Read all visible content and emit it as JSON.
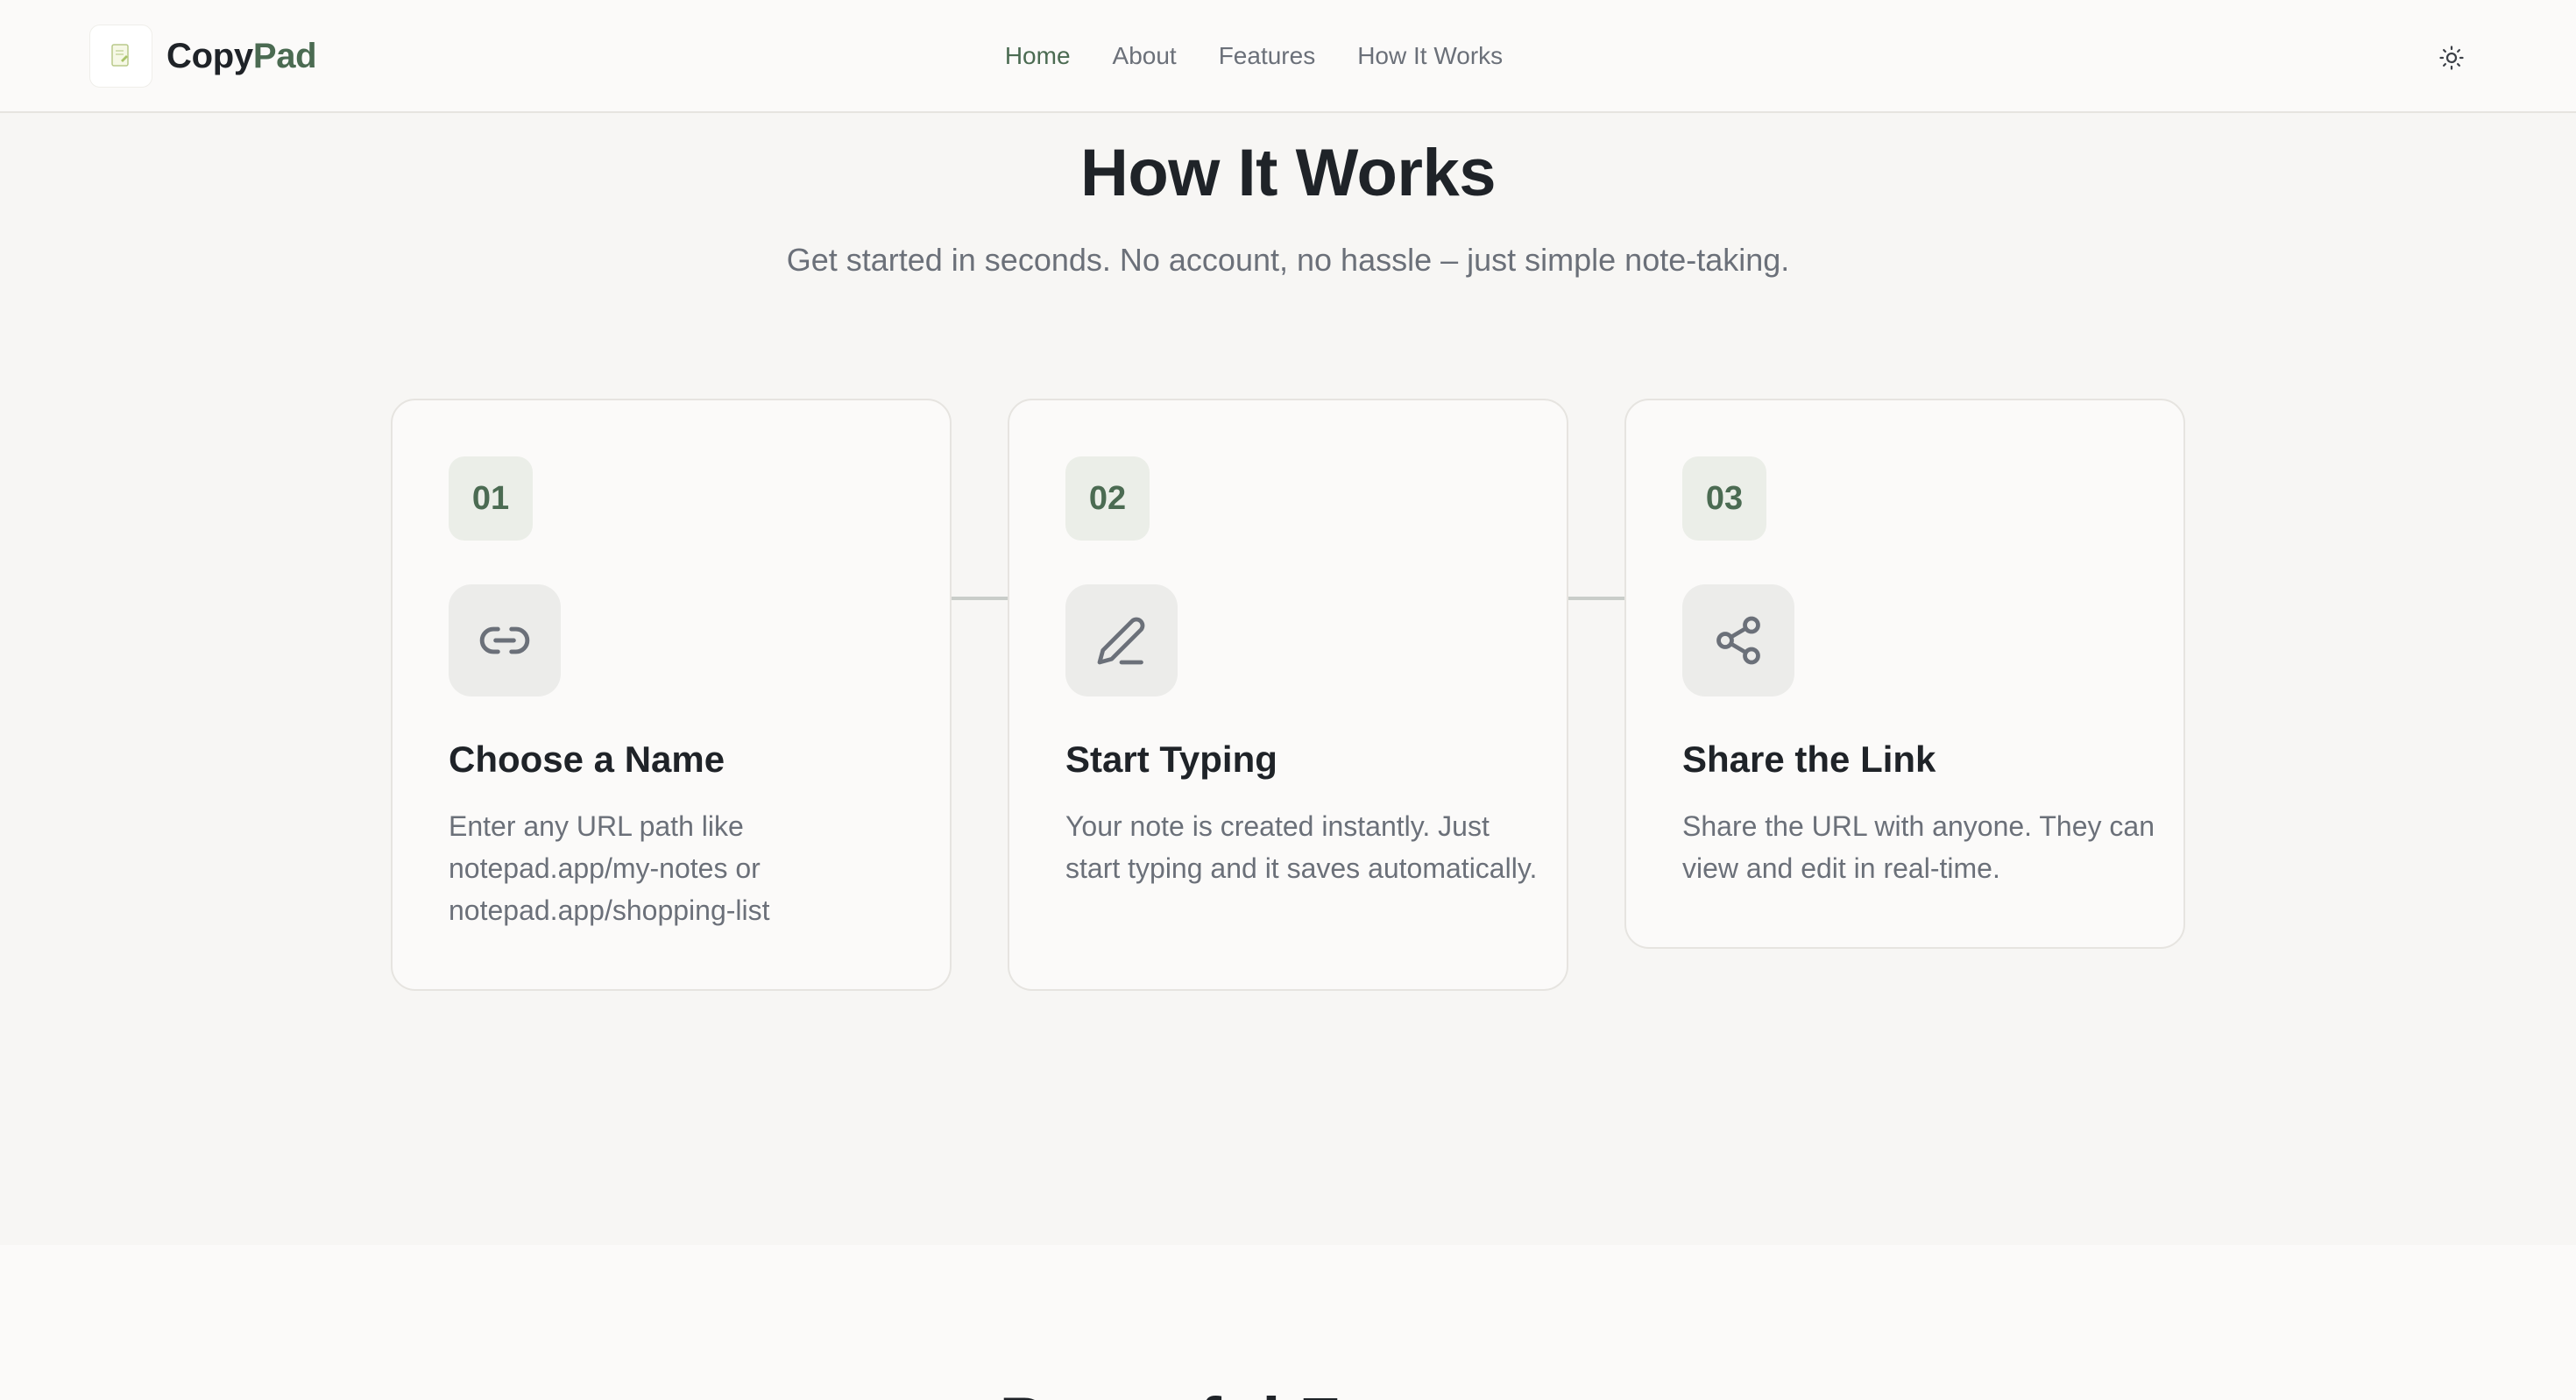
{
  "brand": {
    "name_part1": "Copy",
    "name_part2": "Pad"
  },
  "nav": {
    "items": [
      {
        "label": "Home",
        "active": true
      },
      {
        "label": "About",
        "active": false
      },
      {
        "label": "Features",
        "active": false
      },
      {
        "label": "How It Works",
        "active": false
      }
    ]
  },
  "theme_toggle": {
    "icon": "sun-icon"
  },
  "how_it_works": {
    "title": "How It Works",
    "subtitle": "Get started in seconds. No account, no hassle – just simple note-taking.",
    "steps": [
      {
        "number": "01",
        "icon": "link-icon",
        "title": "Choose a Name",
        "description": "Enter any URL path like notepad.app/my-notes or notepad.app/shopping-list"
      },
      {
        "number": "02",
        "icon": "pencil-icon",
        "title": "Start Typing",
        "description": "Your note is created instantly. Just start typing and it saves automatically."
      },
      {
        "number": "03",
        "icon": "share-icon",
        "title": "Share the Link",
        "description": "Share the URL with anyone. They can view and edit in real-time."
      }
    ]
  },
  "next_section": {
    "title": "Powerful Features"
  },
  "colors": {
    "accent": "#4b6b52",
    "text": "#1f2328",
    "muted": "#6b7079",
    "page_bg": "#f7f6f4",
    "card_bg": "#fbfaf9"
  }
}
